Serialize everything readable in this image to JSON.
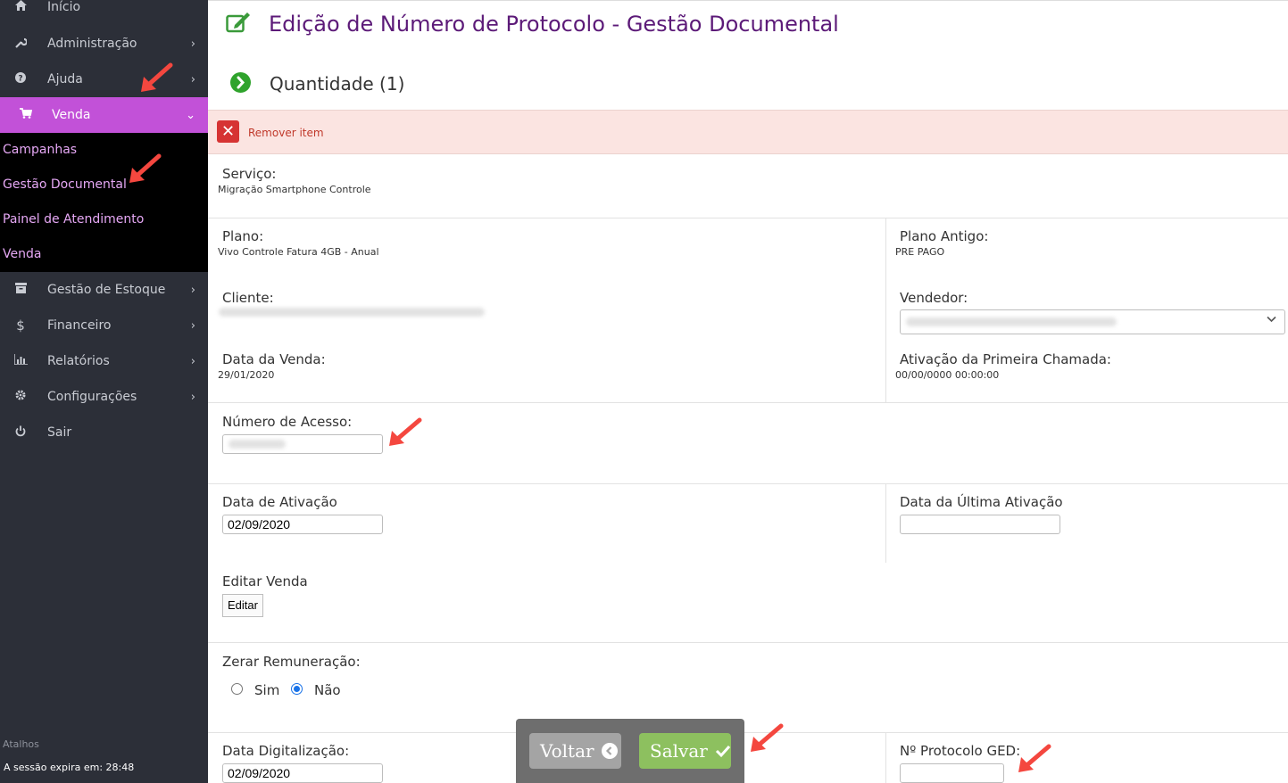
{
  "sidebar": {
    "items": [
      {
        "label": "Início",
        "icon": "home-icon"
      },
      {
        "label": "Administração",
        "icon": "wrench-icon"
      },
      {
        "label": "Ajuda",
        "icon": "question-icon"
      },
      {
        "label": "Venda",
        "icon": "cart-icon"
      },
      {
        "label": "Gestão de Estoque",
        "icon": "archive-icon"
      },
      {
        "label": "Financeiro",
        "icon": "dollar-icon"
      },
      {
        "label": "Relatórios",
        "icon": "bar-chart-icon"
      },
      {
        "label": "Configurações",
        "icon": "gear-icon"
      },
      {
        "label": "Sair",
        "icon": "power-icon"
      }
    ],
    "submenu": [
      "Campanhas",
      "Gestão Documental",
      "Painel de Atendimento",
      "Venda"
    ],
    "shortcuts_label": "Atalhos",
    "session_text": "A sessão expira em: 28:48"
  },
  "main": {
    "title": "Edição de Número de Protocolo - Gestão Documental",
    "section_title": "Quantidade (1)",
    "remove_item": "Remover item",
    "servico_label": "Serviço:",
    "servico_value": "Migração Smartphone Controle",
    "plano_label": "Plano:",
    "plano_value": "Vivo Controle Fatura 4GB - Anual",
    "plano_antigo_label": "Plano Antigo:",
    "plano_antigo_value": "PRE PAGO",
    "cliente_label": "Cliente:",
    "vendedor_label": "Vendedor:",
    "data_venda_label": "Data da Venda:",
    "data_venda_value": "29/01/2020",
    "ativacao_primeira_label": "Ativação da Primeira Chamada:",
    "ativacao_primeira_value": "00/00/0000 00:00:00",
    "numero_acesso_label": "Número de Acesso:",
    "data_ativacao_label": "Data de Ativação",
    "data_ativacao_value": "02/09/2020",
    "data_ultima_ativacao_label": "Data da Última Ativação",
    "data_ultima_ativacao_value": "",
    "editar_venda_label": "Editar Venda",
    "editar_button": "Editar",
    "zerar_label": "Zerar Remuneração:",
    "radio_sim": "Sim",
    "radio_nao": "Não",
    "zerar_selected": "Não",
    "data_digitalizacao_label": "Data Digitalização:",
    "data_digitalizacao_value": "02/09/2020",
    "protocolo_ged_label": "Nº Protocolo GED:",
    "protocolo_ged_value": ""
  },
  "actions": {
    "back_label": "Voltar",
    "save_label": "Salvar"
  },
  "colors": {
    "sidebar_bg": "#2c2f38",
    "active_item": "#c251d8",
    "title": "#5c1a78",
    "save": "#8dc05f",
    "annotation_arrow": "#f4473f"
  }
}
